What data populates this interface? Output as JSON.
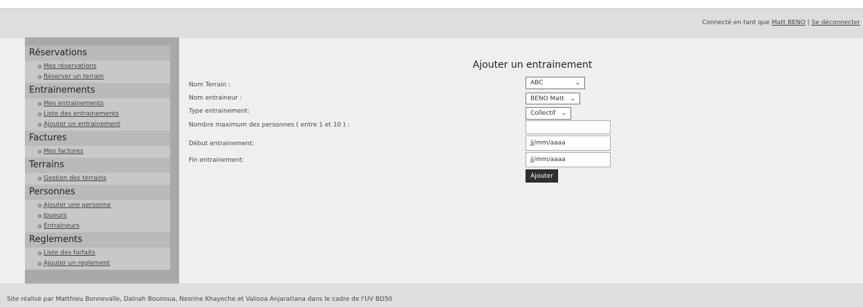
{
  "header": {
    "connected_prefix": "Connecté en tant que ",
    "user_link": "Matt BENO",
    "separator": " | ",
    "logout_link": "Se déconnecter"
  },
  "sidebar": {
    "sections": [
      {
        "title": "Réservations",
        "items": [
          "Mes réservations",
          "Réserver un terrain"
        ]
      },
      {
        "title": "Entrainements",
        "items": [
          "Mes entrainements",
          "Liste des entrainements",
          "Ajouter un entrainement"
        ]
      },
      {
        "title": "Factures",
        "items": [
          "Mes factures"
        ]
      },
      {
        "title": "Terrains",
        "items": [
          "Gestion des terrains"
        ]
      },
      {
        "title": "Personnes",
        "items": [
          "Ajouter une personne",
          "Joueurs",
          "Entraineurs"
        ]
      },
      {
        "title": "Reglements",
        "items": [
          "Liste des forfaits",
          "Ajouter un reglement"
        ]
      }
    ]
  },
  "form": {
    "title": "Ajouter un entrainement",
    "terrain_label": "Nom Terrain :",
    "terrain_value": "ABC",
    "coach_label": "Nom entraineur :",
    "coach_value": "BENO Matt",
    "type_label": "Type entrainement:",
    "type_value": "Collectif",
    "max_label": "Nombre maximum des personnes ( entre 1 et 10 ) :",
    "max_value": "",
    "start_label": "Début entrainement:",
    "start_placeholder": "jj/mm/aaaa",
    "end_label": "Fin entrainement:",
    "end_placeholder": "jj/mm/aaaa",
    "submit_label": "Ajouter"
  },
  "footer": {
    "text": "Site réalisé par Matthieu Bonnevalle, Daïnah Bounoua, Nesrine Khayeche et Valisoa Anjaratiana dans le cadre de l'UV BD50"
  }
}
